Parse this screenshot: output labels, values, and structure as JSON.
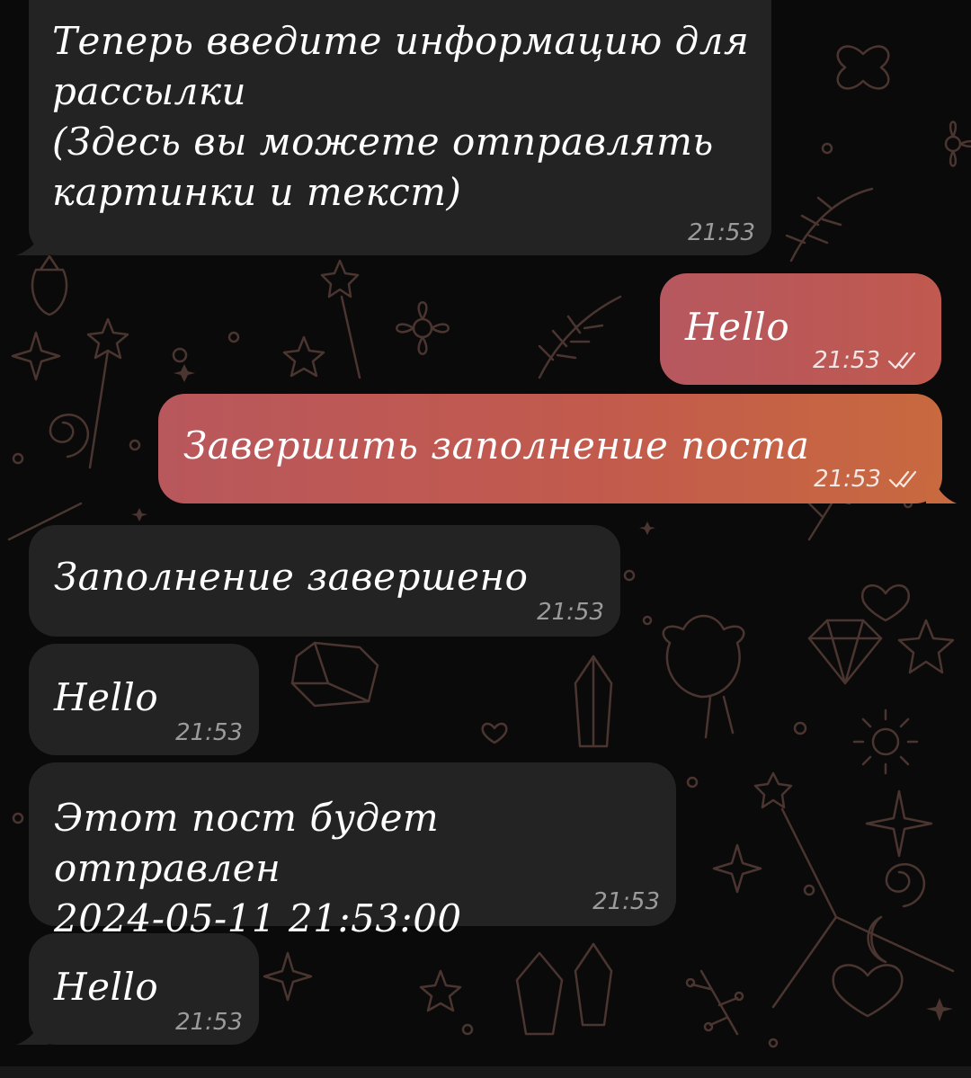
{
  "chat": {
    "messages": [
      {
        "direction": "incoming",
        "text": "Теперь введите информацию для\nрассылки\n(Здесь вы можете отправлять\nкартинки и текст)",
        "time": "21:53"
      },
      {
        "direction": "outgoing",
        "text": "Hello",
        "time": "21:53",
        "status": "read"
      },
      {
        "direction": "outgoing",
        "text": "Завершить заполнение поста",
        "time": "21:53",
        "status": "read"
      },
      {
        "direction": "incoming",
        "text": "Заполнение завершено",
        "time": "21:53"
      },
      {
        "direction": "incoming",
        "text": "Hello",
        "time": "21:53"
      },
      {
        "direction": "incoming",
        "text": "Этот пост будет отправлен\n2024-05-11 21:53:00",
        "time": "21:53"
      },
      {
        "direction": "incoming",
        "text": "Hello",
        "time": "21:53"
      }
    ]
  },
  "theme": {
    "background": "#0b0a0a",
    "incoming_bubble": "#242323",
    "outgoing_bubble_start": "#b8575c",
    "outgoing_bubble_end": "#c86a48",
    "doodle_color": "#4a3530"
  },
  "icons": {
    "read_status": "double-check-icon",
    "wallpaper": "doodle-pattern"
  }
}
